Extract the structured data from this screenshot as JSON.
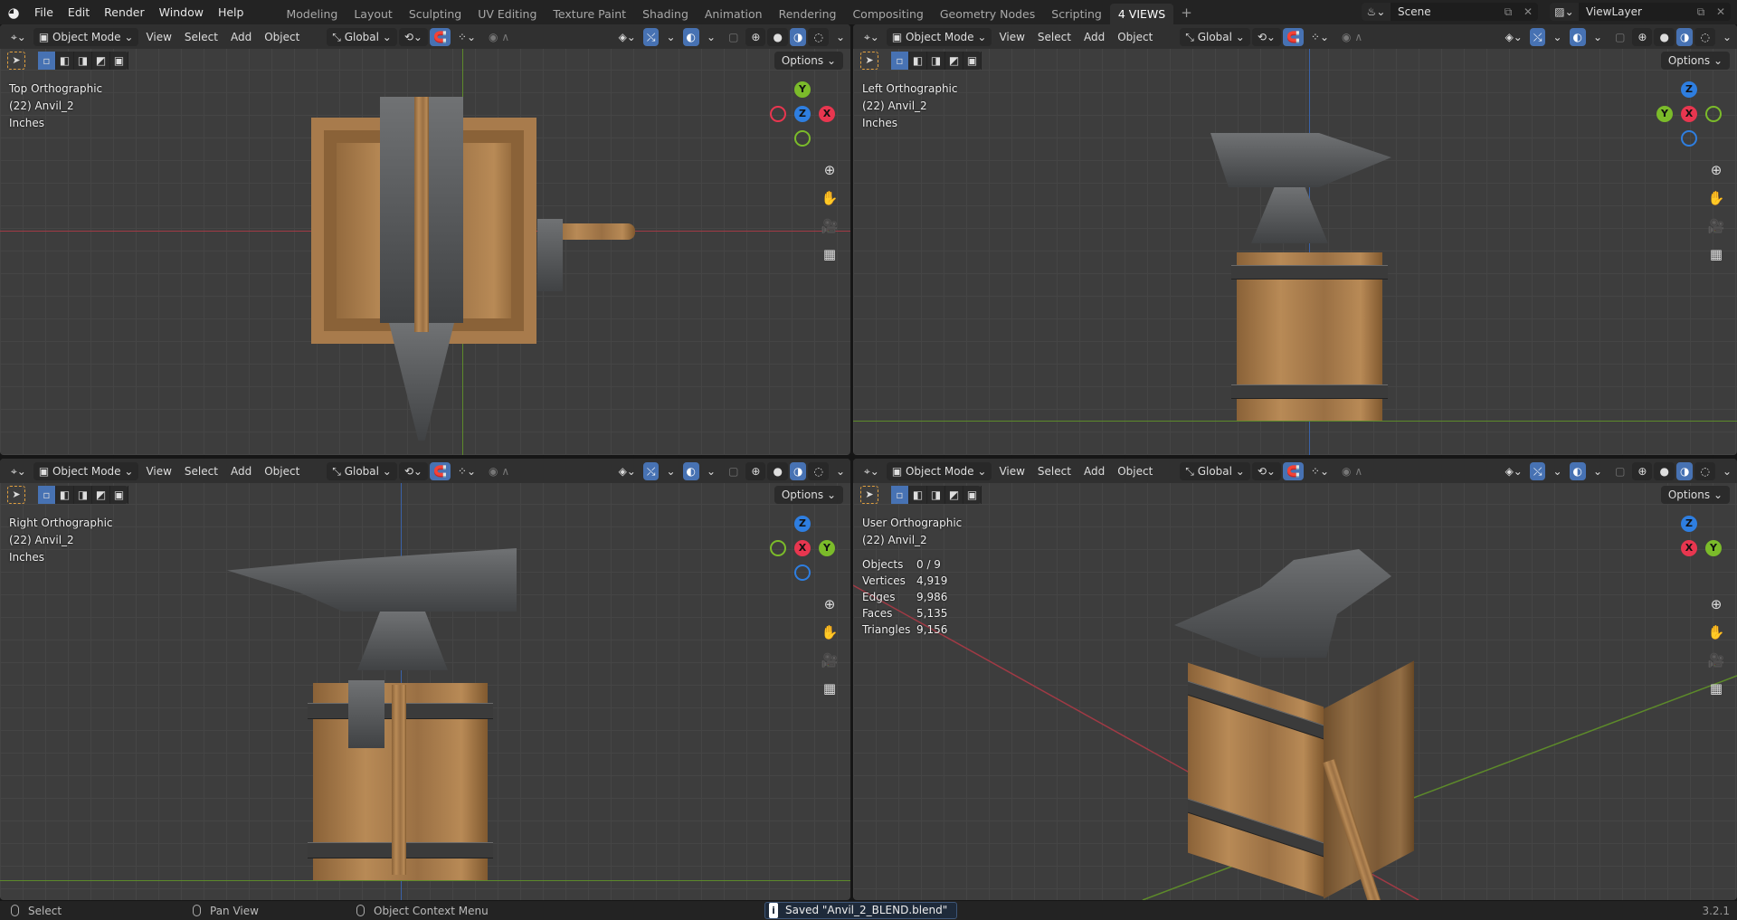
{
  "topbar": {
    "menus": [
      "File",
      "Edit",
      "Render",
      "Window",
      "Help"
    ],
    "workspaces": [
      "Modeling",
      "Layout",
      "Sculpting",
      "UV Editing",
      "Texture Paint",
      "Shading",
      "Animation",
      "Rendering",
      "Compositing",
      "Geometry Nodes",
      "Scripting",
      "4 VIEWS"
    ],
    "active_workspace": "4 VIEWS",
    "add_workspace": "+",
    "scene": "Scene",
    "view_layer": "ViewLayer"
  },
  "header": {
    "mode": "Object Mode",
    "menus": [
      "View",
      "Select",
      "Add",
      "Object"
    ],
    "orientation": "Global",
    "options": "Options"
  },
  "viewports": [
    {
      "title": "Top Orthographic",
      "object": "(22) Anvil_2",
      "units": "Inches",
      "gizmo": {
        "up": "Y",
        "right": "X",
        "center": "Z"
      }
    },
    {
      "title": "Left Orthographic",
      "object": "(22) Anvil_2",
      "units": "Inches",
      "gizmo": {
        "up": "Z",
        "right": "",
        "left": "Y",
        "center": "X"
      }
    },
    {
      "title": "Right Orthographic",
      "object": "(22) Anvil_2",
      "units": "Inches",
      "gizmo": {
        "up": "Z",
        "right": "Y",
        "center": "X"
      }
    },
    {
      "title": "User Orthographic",
      "object": "(22) Anvil_2",
      "gizmo": {
        "up": "Z",
        "right": "Y",
        "center": "X"
      }
    }
  ],
  "stats": [
    {
      "label": "Objects",
      "value": "0 / 9"
    },
    {
      "label": "Vertices",
      "value": "4,919"
    },
    {
      "label": "Edges",
      "value": "9,986"
    },
    {
      "label": "Faces",
      "value": "5,135"
    },
    {
      "label": "Triangles",
      "value": "9,156"
    }
  ],
  "status": {
    "select": "Select",
    "pan": "Pan View",
    "context": "Object Context Menu",
    "message": "Saved \"Anvil_2_BLEND.blend\"",
    "version": "3.2.1"
  },
  "colors": {
    "x": "#e8364f",
    "y": "#7bbb2a",
    "z": "#2e7ee0",
    "accent": "#4772b3"
  }
}
